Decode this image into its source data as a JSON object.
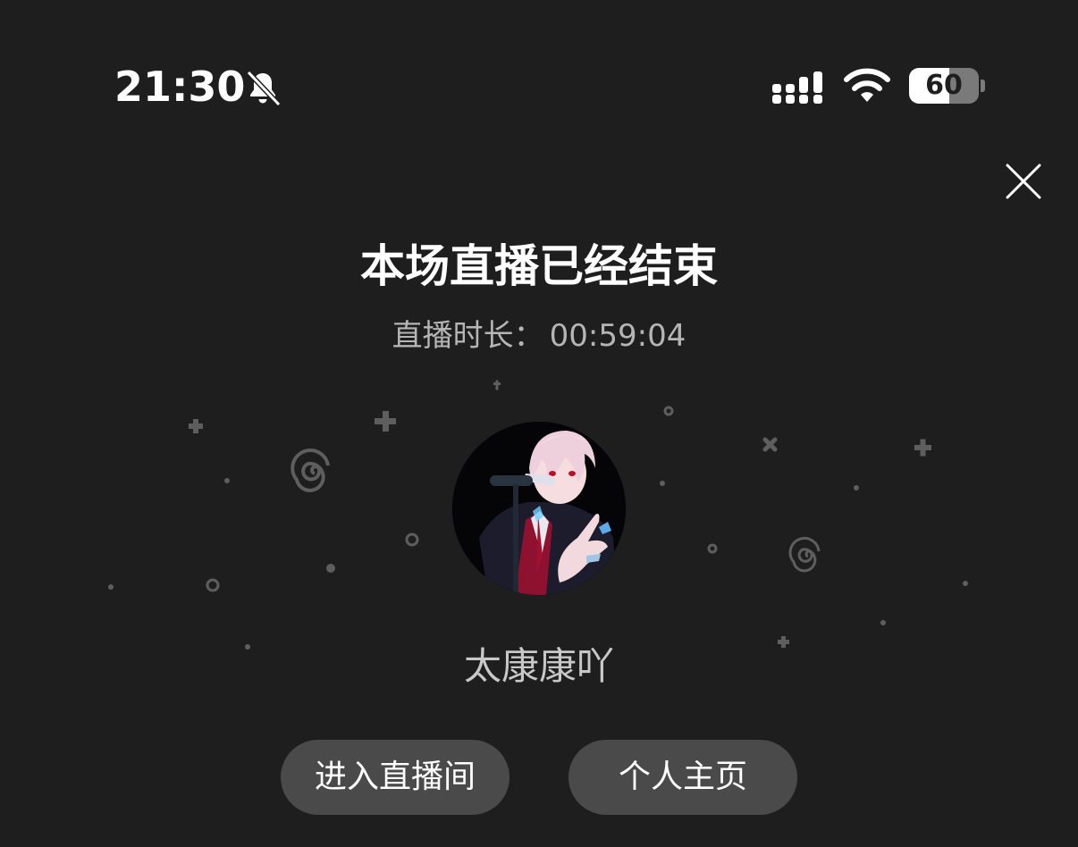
{
  "status_bar": {
    "time": "21:30",
    "battery_level": "60",
    "icons": [
      "bell-muted-icon",
      "signal-icon",
      "wifi-icon",
      "battery-icon"
    ]
  },
  "header": {
    "close_icon": "close-icon"
  },
  "main": {
    "title": "本场直播已经结束",
    "duration_label": "直播时长：",
    "duration_value": "00:59:04",
    "username": "太康康吖"
  },
  "actions": {
    "enter_room_label": "进入直播间",
    "profile_label": "个人主页"
  },
  "colors": {
    "background": "#1e1e1e",
    "button": "#4a4a4a",
    "title": "#ffffff",
    "subtext": "#b5b5b5",
    "decor": "#5e5e5e"
  }
}
